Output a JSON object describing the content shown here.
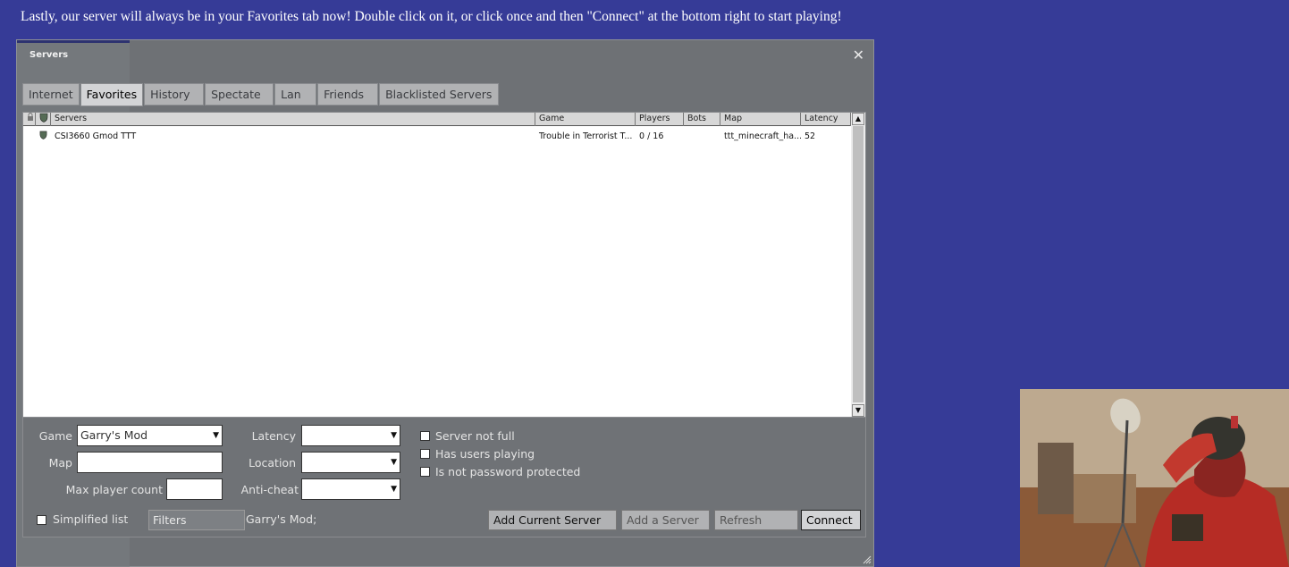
{
  "instruction_text": "Lastly, our server will always be in your Favorites tab now! Double click on it, or click once and then \"Connect\" at the bottom right to start playing!",
  "window": {
    "title": "Servers",
    "close_glyph": "✕"
  },
  "tabs": [
    {
      "label": "Internet",
      "active": false
    },
    {
      "label": "Favorites",
      "active": true
    },
    {
      "label": "History",
      "active": false
    },
    {
      "label": "Spectate",
      "active": false
    },
    {
      "label": "Lan",
      "active": false
    },
    {
      "label": "Friends",
      "active": false
    },
    {
      "label": "Blacklisted Servers",
      "active": false
    }
  ],
  "list": {
    "columns": [
      "Servers",
      "Game",
      "Players",
      "Bots",
      "Map",
      "Latency"
    ],
    "icon_columns": [
      "lock-icon",
      "shield-icon"
    ],
    "rows": [
      {
        "name": "CSI3660 Gmod TTT",
        "game": "Trouble in Terrorist T...",
        "players": "0 / 16",
        "bots": "",
        "map": "ttt_minecraft_ha...",
        "latency": "52"
      }
    ]
  },
  "filters": {
    "game_label": "Game",
    "game_value": "Garry's Mod",
    "map_label": "Map",
    "map_value": "",
    "max_player_label": "Max player count",
    "max_player_value": "",
    "latency_label": "Latency",
    "latency_value": "",
    "location_label": "Location",
    "location_value": "",
    "anticheat_label": "Anti-cheat",
    "anticheat_value": "",
    "server_not_full": "Server not full",
    "has_users_playing": "Has users playing",
    "not_password_protected": "Is not password protected",
    "simplified_list": "Simplified list",
    "filters_button": "Filters",
    "summary": "Garry's Mod;"
  },
  "buttons": {
    "add_current_server": "Add Current Server",
    "add_a_server": "Add a Server",
    "refresh": "Refresh",
    "connect": "Connect"
  }
}
